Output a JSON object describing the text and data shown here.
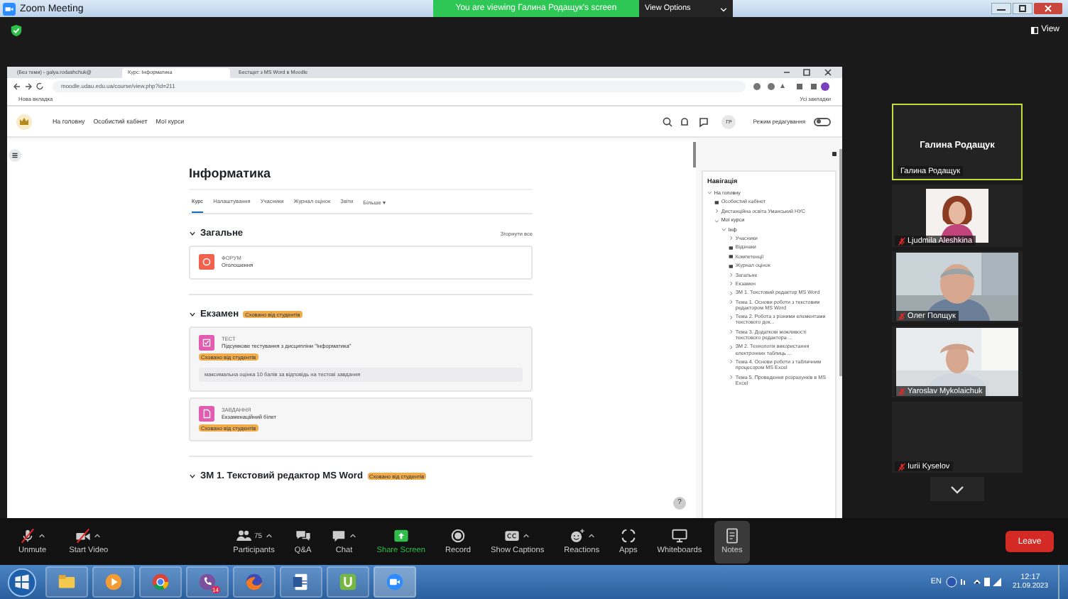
{
  "window": {
    "title": "Zoom Meeting"
  },
  "banner": {
    "text": "You are viewing Галина Родащук's screen",
    "options": "View Options"
  },
  "view_button": "View",
  "browser": {
    "tabs": [
      {
        "label": "(Без теми) - galya.rodashchuk@",
        "selected": false
      },
      {
        "label": "Курс: Інформатика",
        "selected": true
      },
      {
        "label": "Бестщет з MS Word в Moodle",
        "selected": false
      }
    ],
    "address": "moodle.udau.edu.ua/course/view.php?id=211",
    "bookmark": "Нова вкладка",
    "all_bookmarks": "Усі закладки"
  },
  "moodle": {
    "nav": [
      "На головну",
      "Особистий кабінет",
      "Мої курси"
    ],
    "user": "ГР",
    "edit_mode": {
      "label": "Режим редагування",
      "on": false
    },
    "course_title": "Інформатика",
    "tabs": [
      {
        "label": "Курс",
        "selected": true
      },
      {
        "label": "Налаштування",
        "selected": false
      },
      {
        "label": "Учасники",
        "selected": false
      },
      {
        "label": "Журнал оцінок",
        "selected": false
      },
      {
        "label": "Звіти",
        "selected": false
      },
      {
        "label": "Більше ▾",
        "selected": false
      }
    ],
    "collapse_all": "Згорнути все",
    "sections": [
      {
        "title": "Загальне",
        "activities": [
          {
            "kind": "forum",
            "type": "ФОРУМ",
            "name": "Оголошення"
          }
        ]
      },
      {
        "title": "Екзамен",
        "badge": "Сховано від студентів",
        "activities": [
          {
            "kind": "quiz",
            "type": "ТЕСТ",
            "name": "Підсумкове тестування з дисципліни \"Інформатика\"",
            "badge": "Сховано від студентів",
            "note": "максимальна оцінка 10 балів за відповідь на тестові завдання"
          },
          {
            "kind": "assign",
            "type": "ЗАВДАННЯ",
            "name": "Екзаменаційний білет",
            "badge": "Сховано від студентів"
          }
        ]
      },
      {
        "title": "ЗМ 1. Текстовий редактор MS Word",
        "badge": "Сховано від студентів"
      }
    ],
    "help": "?"
  },
  "navigation": {
    "title": "Навігація",
    "items": [
      {
        "label": "На головну",
        "expanded": true,
        "children": [
          {
            "label": "Особистий кабінет"
          },
          {
            "label": "Дистанційна освіта Уманський НУС",
            "expanded": false
          },
          {
            "label": "Мої курси",
            "expanded": true,
            "children": [
              {
                "label": "Інф",
                "expanded": true,
                "children": [
                  {
                    "label": "Учасники",
                    "expanded": false
                  },
                  {
                    "label": "Відзнаки"
                  },
                  {
                    "label": "Компетенції"
                  },
                  {
                    "label": "Журнал оцінок"
                  },
                  {
                    "label": "Загальне",
                    "expanded": false
                  },
                  {
                    "label": "Екзамен",
                    "expanded": false
                  },
                  {
                    "label": "ЗМ 1. Текстовий редактор MS Word",
                    "expanded": false
                  },
                  {
                    "label": "Тема 1. Основи роботи з текстовим редактором MS Word",
                    "expanded": false
                  },
                  {
                    "label": "Тема 2. Робота з різними елементами текстового док...",
                    "expanded": false
                  },
                  {
                    "label": "Тема 3. Додаткові можливості текстового редактора ...",
                    "expanded": false
                  },
                  {
                    "label": "ЗМ 2. Технологія використання електронних таблиць ...",
                    "expanded": false
                  },
                  {
                    "label": "Тема 4. Основи роботи з табличним процесором MS Excel",
                    "expanded": false
                  },
                  {
                    "label": "Тема 5. Проведення розрахунків в MS Excel",
                    "expanded": false
                  }
                ]
              }
            ]
          }
        ]
      }
    ]
  },
  "participants": [
    {
      "kind": "name",
      "display_name": "Галина Родащук",
      "name": "Галина Родащук",
      "active": true,
      "muted": false
    },
    {
      "name": "Ljudmila Aleshkina",
      "active": false,
      "muted": true
    },
    {
      "kind": "video",
      "name": "Олег Полщук",
      "active": false,
      "muted": true
    },
    {
      "kind": "video",
      "name": "Yaroslav Mykolaichuk",
      "active": false,
      "muted": true
    },
    {
      "kind": "off",
      "name": "Iurii Kyselov",
      "active": false,
      "muted": true
    }
  ],
  "toolbar": [
    {
      "label": "Unmute",
      "off": true,
      "caret": true,
      "selected": false
    },
    {
      "label": "Start Video",
      "off": true,
      "caret": true,
      "selected": false
    },
    {
      "label": "Participants",
      "count": "75",
      "caret": true,
      "selected": false
    },
    {
      "label": "Q&A",
      "selected": false
    },
    {
      "label": "Chat",
      "caret": true,
      "selected": false
    },
    {
      "label": "Share Screen",
      "kind": "share",
      "selected": false
    },
    {
      "label": "Record",
      "selected": false
    },
    {
      "label": "Show Captions",
      "caret": true,
      "selected": false
    },
    {
      "label": "Reactions",
      "caret": true,
      "selected": false
    },
    {
      "label": "Apps",
      "selected": false
    },
    {
      "label": "Whiteboards",
      "selected": false
    },
    {
      "label": "Notes",
      "selected": true
    }
  ],
  "leave": "Leave",
  "taskbar": {
    "badge": "14",
    "language": "EN",
    "time": "12:17",
    "date": "21.09.2023"
  }
}
